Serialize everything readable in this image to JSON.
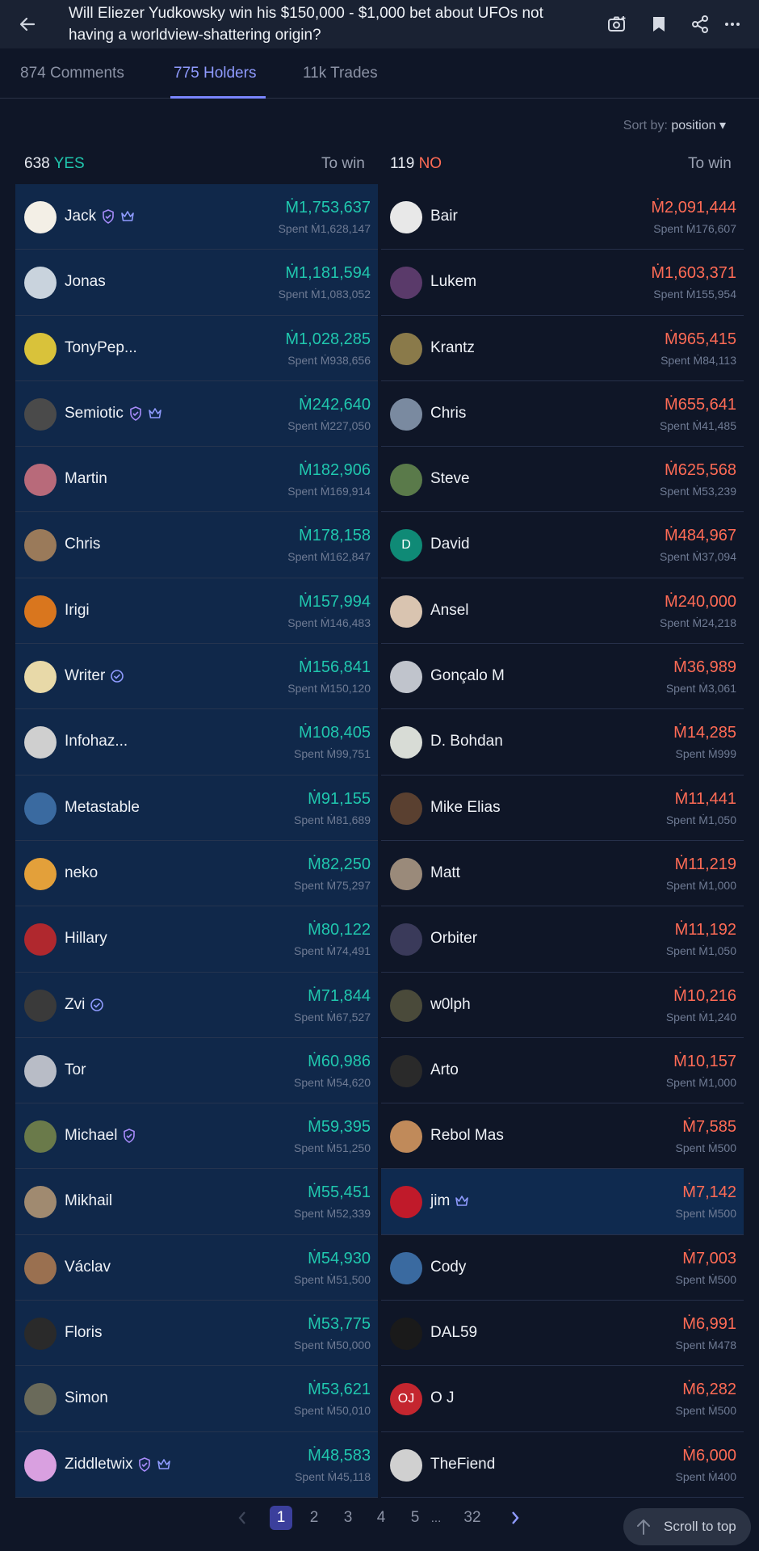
{
  "header": {
    "title": "Will Eliezer Yudkowsky win his $150,000 - $1,000 bet about UFOs not having a worldview-shattering origin?"
  },
  "tabs": [
    {
      "label": "874 Comments"
    },
    {
      "label": "775 Holders"
    },
    {
      "label": "11k Trades"
    }
  ],
  "sort": {
    "prefix": "Sort by:",
    "value": "position",
    "arrow": "▾"
  },
  "yes_side": {
    "count": "638",
    "label": "YES",
    "towin": "To win"
  },
  "no_side": {
    "count": "119",
    "label": "NO",
    "towin": "To win"
  },
  "yes_holders": [
    {
      "name": "Jack",
      "amount": "Ṁ1,753,637",
      "spent": "Spent Ṁ1,628,147",
      "shield": true,
      "crown": true,
      "avatar_color": "#f3efe6"
    },
    {
      "name": "Jonas",
      "amount": "Ṁ1,181,594",
      "spent": "Spent Ṁ1,083,052",
      "avatar_color": "#c9d3dd"
    },
    {
      "name": "TonyPep...",
      "amount": "Ṁ1,028,285",
      "spent": "Spent Ṁ938,656",
      "avatar_color": "#d9c23a"
    },
    {
      "name": "Semiotic",
      "amount": "Ṁ242,640",
      "spent": "Spent Ṁ227,050",
      "shield": true,
      "crown": true,
      "avatar_color": "#4a4a4a"
    },
    {
      "name": "Martin",
      "amount": "Ṁ182,906",
      "spent": "Spent Ṁ169,914",
      "avatar_color": "#b86a7a"
    },
    {
      "name": "Chris",
      "amount": "Ṁ178,158",
      "spent": "Spent Ṁ162,847",
      "avatar_color": "#9a7a5a"
    },
    {
      "name": "Irigi",
      "amount": "Ṁ157,994",
      "spent": "Spent Ṁ146,483",
      "avatar_color": "#d9761e"
    },
    {
      "name": "Writer",
      "amount": "Ṁ156,841",
      "spent": "Spent Ṁ150,120",
      "verified": true,
      "avatar_color": "#e8d9a8"
    },
    {
      "name": "Infohaz...",
      "amount": "Ṁ108,405",
      "spent": "Spent Ṁ99,751",
      "avatar_color": "#cfcfcf"
    },
    {
      "name": "Metastable",
      "amount": "Ṁ91,155",
      "spent": "Spent Ṁ81,689",
      "avatar_color": "#3a6aa0"
    },
    {
      "name": "neko",
      "amount": "Ṁ82,250",
      "spent": "Spent Ṁ75,297",
      "avatar_color": "#e3a03a"
    },
    {
      "name": "Hillary",
      "amount": "Ṁ80,122",
      "spent": "Spent Ṁ74,491",
      "avatar_color": "#b0282e"
    },
    {
      "name": "Zvi",
      "amount": "Ṁ71,844",
      "spent": "Spent Ṁ67,527",
      "verified": true,
      "avatar_color": "#3a3a3a"
    },
    {
      "name": "Tor",
      "amount": "Ṁ60,986",
      "spent": "Spent Ṁ54,620",
      "avatar_color": "#b8bcc6"
    },
    {
      "name": "Michael",
      "amount": "Ṁ59,395",
      "spent": "Spent Ṁ51,250",
      "shield": true,
      "avatar_color": "#6a7a4a"
    },
    {
      "name": "Mikhail",
      "amount": "Ṁ55,451",
      "spent": "Spent Ṁ52,339",
      "avatar_color": "#a08a70"
    },
    {
      "name": "Václav",
      "amount": "Ṁ54,930",
      "spent": "Spent Ṁ51,500",
      "avatar_color": "#9a7050"
    },
    {
      "name": "Floris",
      "amount": "Ṁ53,775",
      "spent": "Spent Ṁ50,000",
      "avatar_color": "#2a2a2a"
    },
    {
      "name": "Simon",
      "amount": "Ṁ53,621",
      "spent": "Spent Ṁ50,010",
      "avatar_color": "#6a6a5a"
    },
    {
      "name": "Ziddletwix",
      "amount": "Ṁ48,583",
      "spent": "Spent Ṁ45,118",
      "shield": true,
      "crown": true,
      "avatar_color": "#d9a0e0"
    }
  ],
  "no_holders": [
    {
      "name": "Bair",
      "amount": "Ṁ2,091,444",
      "spent": "Spent Ṁ176,607",
      "avatar_color": "#e8e8e8"
    },
    {
      "name": "Lukem",
      "amount": "Ṁ1,603,371",
      "spent": "Spent Ṁ155,954",
      "avatar_color": "#5a3a6a"
    },
    {
      "name": "Krantz",
      "amount": "Ṁ965,415",
      "spent": "Spent Ṁ84,113",
      "avatar_color": "#8a7a4a"
    },
    {
      "name": "Chris",
      "amount": "Ṁ655,641",
      "spent": "Spent Ṁ41,485",
      "avatar_color": "#7a8aa0"
    },
    {
      "name": "Steve",
      "amount": "Ṁ625,568",
      "spent": "Spent Ṁ53,239",
      "avatar_color": "#5a7a4a"
    },
    {
      "name": "David",
      "amount": "Ṁ484,967",
      "spent": "Spent Ṁ37,094",
      "letter": "D",
      "avatar_color": "#0f8a76"
    },
    {
      "name": "Ansel",
      "amount": "Ṁ240,000",
      "spent": "Spent Ṁ24,218",
      "avatar_color": "#d9c4b0"
    },
    {
      "name": "Gonçalo M",
      "amount": "Ṁ36,989",
      "spent": "Spent Ṁ3,061",
      "avatar_color": "#c0c4cc"
    },
    {
      "name": "D. Bohdan",
      "amount": "Ṁ14,285",
      "spent": "Spent Ṁ999",
      "avatar_color": "#d8dcd6"
    },
    {
      "name": "Mike Elias",
      "amount": "Ṁ11,441",
      "spent": "Spent Ṁ1,050",
      "avatar_color": "#5a4030"
    },
    {
      "name": "Matt",
      "amount": "Ṁ11,219",
      "spent": "Spent Ṁ1,000",
      "avatar_color": "#9a8a7a"
    },
    {
      "name": "Orbiter",
      "amount": "Ṁ11,192",
      "spent": "Spent Ṁ1,050",
      "avatar_color": "#3a3a5a"
    },
    {
      "name": "w0lph",
      "amount": "Ṁ10,216",
      "spent": "Spent Ṁ1,240",
      "avatar_color": "#4a4a3a"
    },
    {
      "name": "Arto",
      "amount": "Ṁ10,157",
      "spent": "Spent Ṁ1,000",
      "avatar_color": "#2a2a2a"
    },
    {
      "name": "Rebol Mas",
      "amount": "Ṁ7,585",
      "spent": "Spent Ṁ500",
      "avatar_color": "#c08a5a"
    },
    {
      "name": "jim",
      "amount": "Ṁ7,142",
      "spent": "Spent Ṁ500",
      "crown": true,
      "highlight": true,
      "avatar_color": "#c01a2a"
    },
    {
      "name": "Cody",
      "amount": "Ṁ7,003",
      "spent": "Spent Ṁ500",
      "avatar_color": "#3a6aa0"
    },
    {
      "name": "DAL59",
      "amount": "Ṁ6,991",
      "spent": "Spent Ṁ478",
      "avatar_color": "#1a1a1a"
    },
    {
      "name": "O J",
      "amount": "Ṁ6,282",
      "spent": "Spent Ṁ500",
      "letter": "OJ",
      "avatar_color": "#c4262f"
    },
    {
      "name": "TheFiend",
      "amount": "Ṁ6,000",
      "spent": "Spent Ṁ400",
      "avatar_color": "#d0d0d0"
    }
  ],
  "pagination": {
    "pages": [
      "1",
      "2",
      "3",
      "4",
      "5",
      "...",
      "32"
    ],
    "current": "1"
  },
  "scroll_top": {
    "label": "Scroll to top"
  },
  "colors": {
    "yes": "#20c7ae",
    "no": "#ff6b55",
    "accent": "#7a86ff",
    "background": "#0f1627"
  }
}
